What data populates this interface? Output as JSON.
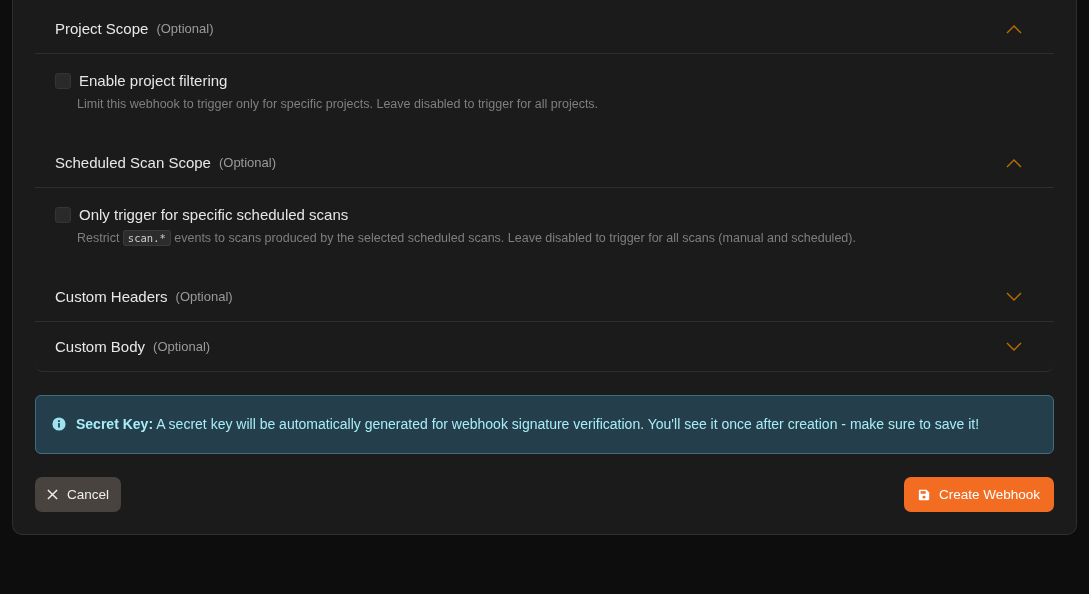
{
  "sections": [
    {
      "title": "Project Scope",
      "optional": "(Optional)",
      "expanded": true,
      "option": {
        "label": "Enable project filtering",
        "checked": false,
        "description": [
          {
            "kind": "text",
            "text": "Limit this webhook to trigger only for specific projects. Leave disabled to trigger for all projects."
          }
        ]
      }
    },
    {
      "title": "Scheduled Scan Scope",
      "optional": "(Optional)",
      "expanded": true,
      "option": {
        "label": "Only trigger for specific scheduled scans",
        "checked": false,
        "description": [
          {
            "kind": "text",
            "text": "Restrict"
          },
          {
            "kind": "code",
            "text": "scan.*"
          },
          {
            "kind": "text",
            "text": "events to scans produced by the selected scheduled scans. Leave disabled to trigger for all scans (manual and scheduled)."
          }
        ]
      }
    },
    {
      "title": "Custom Headers",
      "optional": "(Optional)",
      "expanded": false
    },
    {
      "title": "Custom Body",
      "optional": "(Optional)",
      "expanded": false
    }
  ],
  "alert": {
    "text": "**Secret Key:** A secret key will be automatically generated for webhook signature verification. You'll see it once after creation - make sure to save it!"
  },
  "buttons": {
    "cancel": "Cancel",
    "create": "Create Webhook"
  }
}
